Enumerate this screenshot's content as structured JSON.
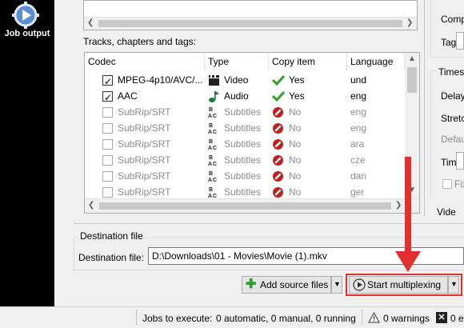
{
  "sidebar": {
    "job_output_label": "Job output"
  },
  "tracks": {
    "section_label": "Tracks, chapters and tags:",
    "columns": [
      "Codec",
      "Type",
      "Copy item",
      "Language"
    ],
    "rows": [
      {
        "codec": "MPEG-4p10/AVC/...",
        "type": "Video",
        "copy": "Yes",
        "lang": "und",
        "checked": true
      },
      {
        "codec": "AAC",
        "type": "Audio",
        "copy": "Yes",
        "lang": "eng",
        "checked": true
      },
      {
        "codec": "SubRip/SRT",
        "type": "Subtitles",
        "copy": "No",
        "lang": "eng",
        "checked": false
      },
      {
        "codec": "SubRip/SRT",
        "type": "Subtitles",
        "copy": "No",
        "lang": "eng",
        "checked": false
      },
      {
        "codec": "SubRip/SRT",
        "type": "Subtitles",
        "copy": "No",
        "lang": "ara",
        "checked": false
      },
      {
        "codec": "SubRip/SRT",
        "type": "Subtitles",
        "copy": "No",
        "lang": "cze",
        "checked": false
      },
      {
        "codec": "SubRip/SRT",
        "type": "Subtitles",
        "copy": "No",
        "lang": "dan",
        "checked": false
      },
      {
        "codec": "SubRip/SRT",
        "type": "Subtitles",
        "copy": "No",
        "lang": "ger",
        "checked": false
      }
    ]
  },
  "right_panel": {
    "labels": [
      "Comp",
      "Tags:",
      "Timest",
      "Delay",
      "Stretc",
      "Defau",
      "Times",
      "Fix",
      "Vide"
    ]
  },
  "destination": {
    "group_label": "Destination file",
    "field_label": "Destination file:",
    "value": "D:\\Downloads\\01 - Movies\\Movie (1).mkv"
  },
  "buttons": {
    "add_source": "Add source files",
    "start": "Start multiplexing"
  },
  "status": {
    "jobs_label": "Jobs to execute:",
    "jobs_value": "0 automatic, 0 manual, 0 running",
    "warnings": "0 warnings",
    "errors": "0 e"
  },
  "colors": {
    "accent_red": "#e03030",
    "yes_green": "#2ea02e",
    "no_red": "#c02020"
  }
}
